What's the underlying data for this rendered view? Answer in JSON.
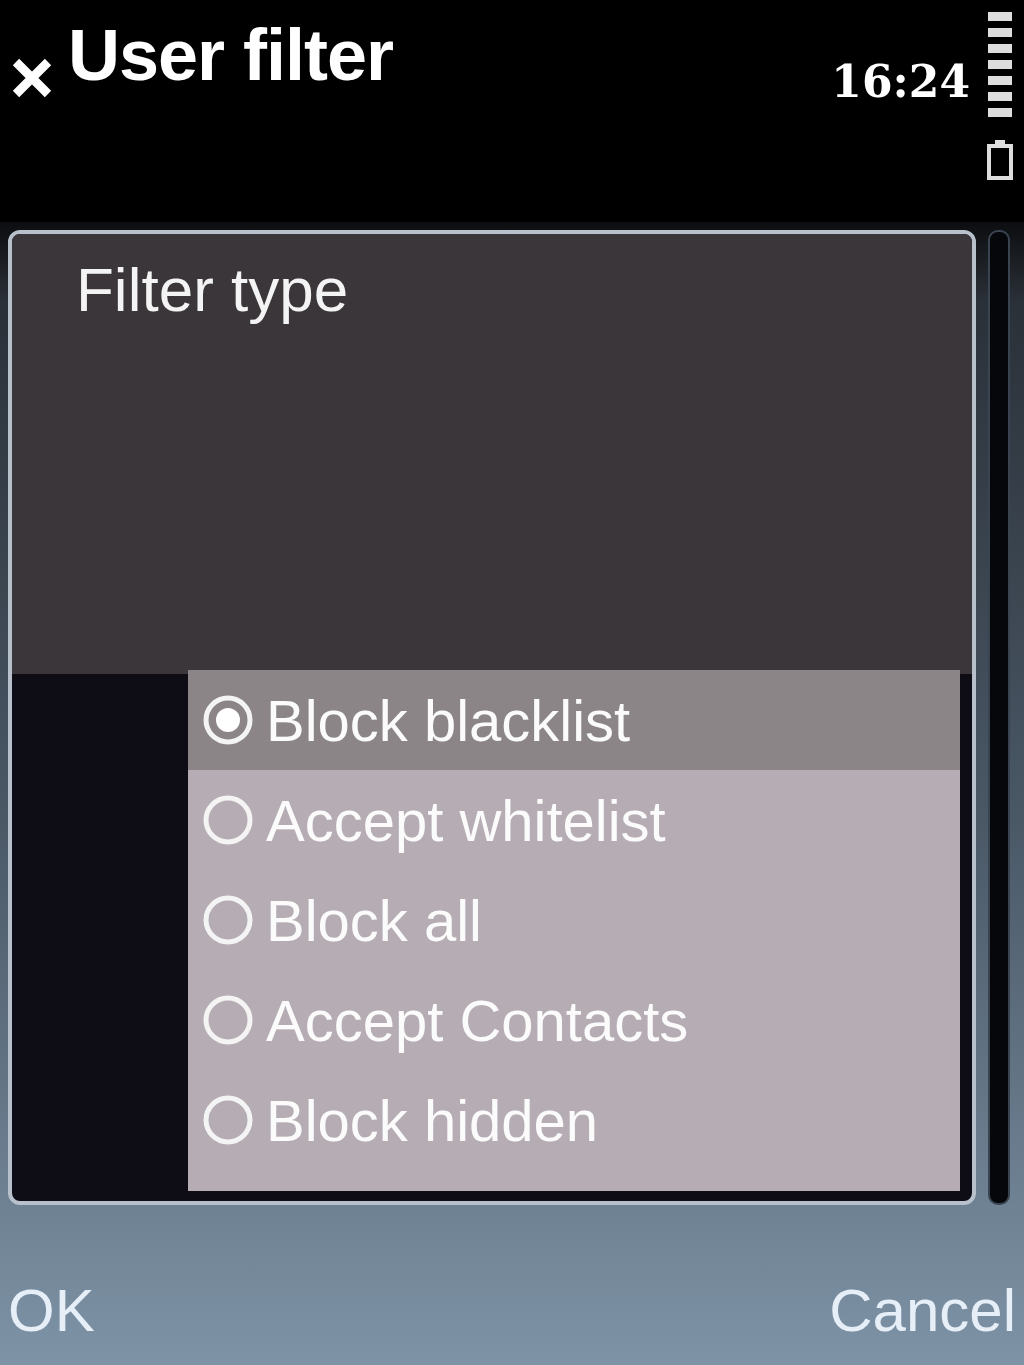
{
  "status_bar": {
    "title": "User filter",
    "time": "16:24"
  },
  "panel": {
    "title": "Filter type"
  },
  "options": [
    {
      "label": "Block blacklist",
      "selected": true
    },
    {
      "label": "Accept whitelist",
      "selected": false
    },
    {
      "label": "Block all",
      "selected": false
    },
    {
      "label": "Accept Contacts",
      "selected": false
    },
    {
      "label": "Block hidden",
      "selected": false
    }
  ],
  "softkeys": {
    "left": "OK",
    "right": "Cancel"
  }
}
